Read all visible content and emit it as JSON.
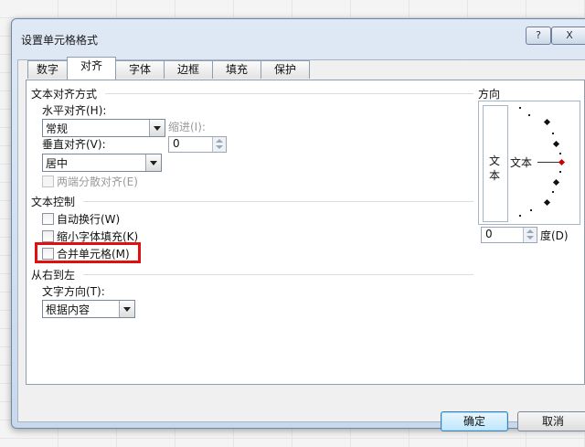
{
  "dialog": {
    "title": "设置单元格格式",
    "help_label": "?",
    "close_label": "X"
  },
  "tabs": [
    "数字",
    "对齐",
    "字体",
    "边框",
    "填充",
    "保护"
  ],
  "active_tab": "对齐",
  "text_alignment": {
    "title": "文本对齐方式",
    "horizontal_label": "水平对齐(H):",
    "horizontal_value": "常规",
    "indent_label": "缩进(I):",
    "indent_value": "0",
    "vertical_label": "垂直对齐(V):",
    "vertical_value": "居中",
    "justify_distributed_label": "两端分散对齐(E)"
  },
  "text_control": {
    "title": "文本控制",
    "wrap_text_label": "自动换行(W)",
    "shrink_to_fit_label": "缩小字体填充(K)",
    "merge_cells_label": "合并单元格(M)"
  },
  "right_to_left": {
    "title": "从右到左",
    "direction_label": "文字方向(T):",
    "direction_value": "根据内容"
  },
  "orientation": {
    "title": "方向",
    "vertical_text": "文本",
    "horizontal_text": "文本",
    "degrees_value": "0",
    "degrees_label": "度(D)"
  },
  "buttons": {
    "ok": "确定",
    "cancel": "取消"
  },
  "colors": {
    "highlight": "#e01010",
    "dialog_frame": "#c9d9ec"
  }
}
